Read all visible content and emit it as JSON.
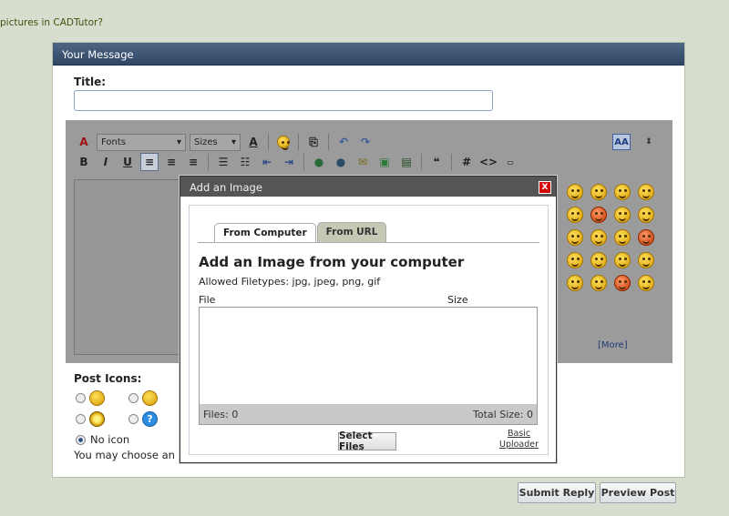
{
  "top_link": "pictures in CADTutor?",
  "panel": {
    "header": "Your Message",
    "title_label": "Title:",
    "title_value": ""
  },
  "toolbar": {
    "font_select": "Fonts",
    "size_select": "Sizes",
    "more_link": "[More]"
  },
  "post_icons": {
    "label": "Post Icons:",
    "no_icon_label": "No icon",
    "choose_text": "You may choose an icon"
  },
  "buttons": {
    "submit": "Submit Reply",
    "preview": "Preview Post"
  },
  "dialog": {
    "title": "Add an Image",
    "close": "X",
    "tabs": [
      {
        "label": "From Computer"
      },
      {
        "label": "From URL"
      }
    ],
    "heading": "Add an Image from your computer",
    "filetypes": "Allowed Filetypes: jpg, jpeg, png, gif",
    "col_file": "File",
    "col_size": "Size",
    "files_count": "Files: 0",
    "total_size": "Total Size: 0",
    "select_files": "Select Files",
    "basic_uploader_line1": "Basic",
    "basic_uploader_line2": "Uploader"
  },
  "colors": {
    "header_bg": "#3b5275",
    "dialog_close": "#d20b0b",
    "page_bg": "#d7ddcf"
  }
}
